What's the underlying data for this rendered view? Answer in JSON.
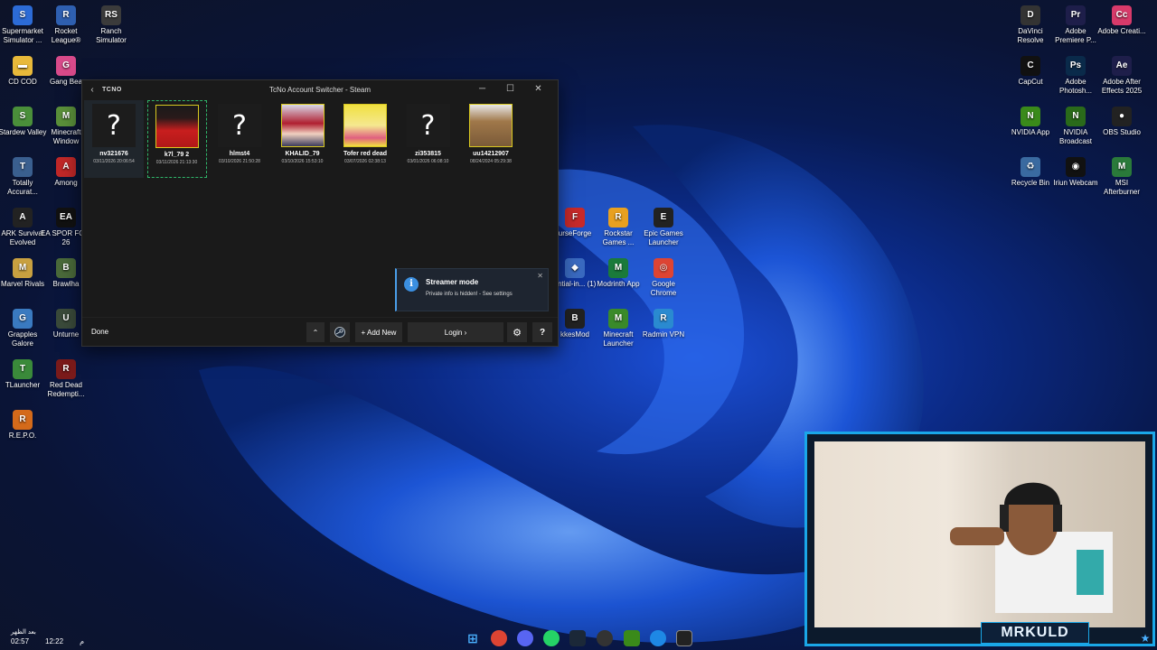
{
  "desktop_left": [
    {
      "label": "Supermarket Simulator ...",
      "color": "#2c6bd6",
      "glyph": "S"
    },
    {
      "label": "Rocket League®",
      "color": "#2e5fb0",
      "glyph": "R"
    },
    {
      "label": "Ranch Simulator",
      "color": "#3b3b3b",
      "glyph": "RS"
    },
    {
      "label": "CD COD",
      "color": "#e8b93a",
      "glyph": "▬"
    },
    {
      "label": "Gang Bea",
      "color": "#d84a8a",
      "glyph": "G"
    },
    {
      "label": "Stardew Valley",
      "color": "#4a8f3a",
      "glyph": "S"
    },
    {
      "label": "Minecraft Window",
      "color": "#5a8f3a",
      "glyph": "M"
    },
    {
      "label": "Totally Accurat...",
      "color": "#3a5f8f",
      "glyph": "T"
    },
    {
      "label": "Among",
      "color": "#c02828",
      "glyph": "A"
    },
    {
      "label": "ARK Survival Evolved",
      "color": "#222",
      "glyph": "A"
    },
    {
      "label": "EA SPOR FC™ 26",
      "color": "#111",
      "glyph": "EA"
    },
    {
      "label": "Marvel Rivals",
      "color": "#c8a040",
      "glyph": "M"
    },
    {
      "label": "Brawlha",
      "color": "#4a6a3a",
      "glyph": "B"
    },
    {
      "label": "Grapples Galore",
      "color": "#3a7ac0",
      "glyph": "G"
    },
    {
      "label": "Unturne",
      "color": "#3a4a3a",
      "glyph": "U"
    },
    {
      "label": "TLauncher",
      "color": "#3a8a3a",
      "glyph": "T"
    },
    {
      "label": "Red Dead Redempti...",
      "color": "#7a1a1a",
      "glyph": "R"
    },
    {
      "label": "R.E.P.O.",
      "color": "#d46a1a",
      "glyph": "R"
    }
  ],
  "desktop_right": [
    {
      "label": "DaVinci Resolve",
      "color": "#333",
      "glyph": "D"
    },
    {
      "label": "Adobe Premiere P...",
      "color": "#1e1e4a",
      "glyph": "Pr"
    },
    {
      "label": "Adobe Creati...",
      "color": "#d83a6a",
      "glyph": "Cc"
    },
    {
      "label": "CapCut",
      "color": "#111",
      "glyph": "C"
    },
    {
      "label": "Adobe Photosh...",
      "color": "#0a2a4a",
      "glyph": "Ps"
    },
    {
      "label": "Adobe After Effects 2025",
      "color": "#1e1e4a",
      "glyph": "Ae"
    },
    {
      "label": "NVIDIA App",
      "color": "#3a8a1a",
      "glyph": "N"
    },
    {
      "label": "NVIDIA Broadcast",
      "color": "#2a6a1a",
      "glyph": "N"
    },
    {
      "label": "OBS Studio",
      "color": "#222",
      "glyph": "●"
    },
    {
      "label": "Recycle Bin",
      "color": "#3a6aa0",
      "glyph": "♻"
    },
    {
      "label": "Iriun Webcam",
      "color": "#111",
      "glyph": "◉"
    },
    {
      "label": "MSI Afterburner",
      "color": "#2a7a3a",
      "glyph": "M"
    }
  ],
  "desktop_mid": [
    {
      "label": "urseForge",
      "color": "#c82a2a",
      "glyph": "F"
    },
    {
      "label": "Rockstar Games ...",
      "color": "#e8a020",
      "glyph": "R"
    },
    {
      "label": "Epic Games Launcher",
      "color": "#222",
      "glyph": "E"
    },
    {
      "label": "ential-in... (1)",
      "color": "#3a6ac0",
      "glyph": "◆"
    },
    {
      "label": "Modrinth App",
      "color": "#1a7a3a",
      "glyph": "M"
    },
    {
      "label": "Google Chrome",
      "color": "#dd4433",
      "glyph": "◎"
    },
    {
      "label": "kkesMod",
      "color": "#222",
      "glyph": "B"
    },
    {
      "label": "Minecraft Launcher",
      "color": "#3a8a2a",
      "glyph": "M"
    },
    {
      "label": "Radmin VPN",
      "color": "#2a8ad0",
      "glyph": "R"
    }
  ],
  "window": {
    "brand": "TCNO",
    "title": "TcNo Account Switcher - Steam",
    "minimize": "─",
    "maximize": "☐",
    "close": "✕",
    "back": "‹"
  },
  "accounts": [
    {
      "name": "nv321676",
      "date": "03/11/2026 20:06:54",
      "avatar": "?",
      "type": "question",
      "state": "hover"
    },
    {
      "name": "k7l_79 2",
      "date": "03/11/2026 21:13:30",
      "avatar": "",
      "type": "red",
      "state": "selected"
    },
    {
      "name": "hlmst4",
      "date": "03/10/2026 21:50:28",
      "avatar": "?",
      "type": "question",
      "state": ""
    },
    {
      "name": "KHALID_79",
      "date": "03/10/2026 15:53:10",
      "avatar": "",
      "type": "anime",
      "state": ""
    },
    {
      "name": "Tofer red dead",
      "date": "03/07/2026 02:38:13",
      "avatar": "",
      "type": "yellow",
      "state": ""
    },
    {
      "name": "zi353815",
      "date": "03/01/2026 06:08:10",
      "avatar": "?",
      "type": "question",
      "state": ""
    },
    {
      "name": "uu14212907",
      "date": "08/24/2024 05:29:38",
      "avatar": "",
      "type": "capybara",
      "state": ""
    }
  ],
  "toast": {
    "title": "Streamer mode",
    "message": "Private info is hidden! - See settings",
    "icon": "i",
    "close": "✕"
  },
  "bottombar": {
    "done": "Done",
    "up": "⌃",
    "add_new": "+ Add New",
    "login": "Login ›",
    "settings": "⚙",
    "help": "?"
  },
  "webcam": {
    "label": "MRKULD"
  },
  "clock": {
    "line1": "بعد الظهر",
    "time1": "02:57",
    "time2": "12:22",
    "date_suffix": "م"
  }
}
